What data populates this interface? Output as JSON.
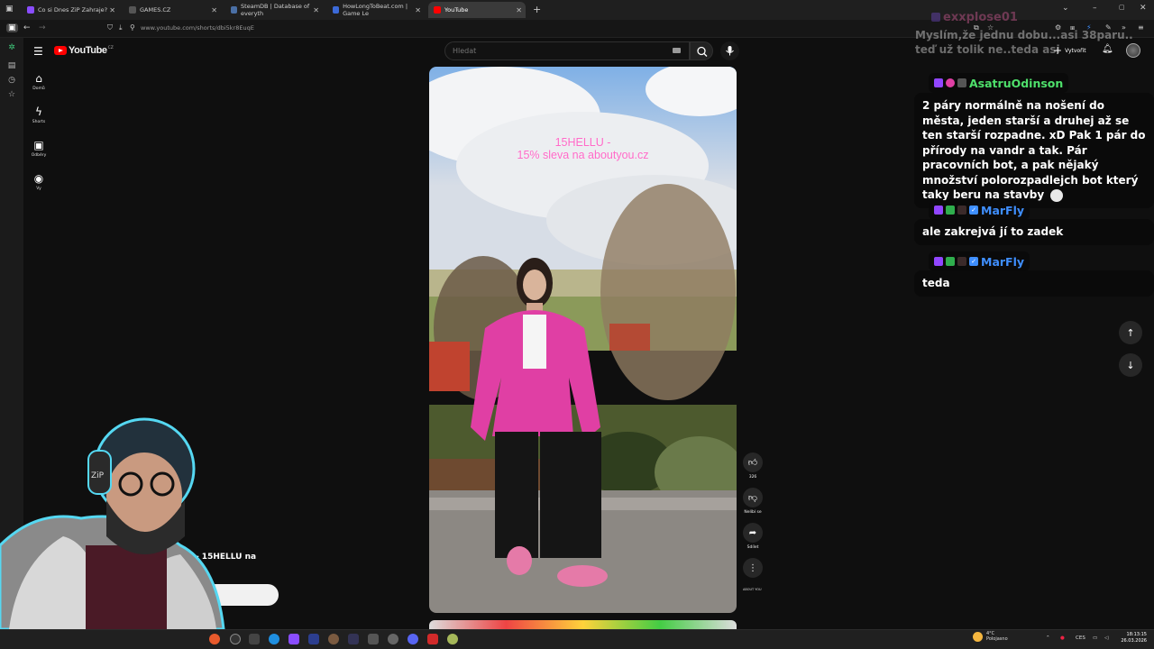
{
  "browser": {
    "tabs": [
      {
        "title": "Co si Dnes ZiP Zahraje?",
        "favicon_color": "#8a4dff"
      },
      {
        "title": "GAMES.CZ",
        "favicon_color": "#2a2a2a"
      },
      {
        "title": "SteamDB | Database of everyth",
        "favicon_color": "#4a6fa5"
      },
      {
        "title": "HowLongToBeat.com | Game Le",
        "favicon_color": "#3c6ad8"
      },
      {
        "title": "YouTube",
        "favicon_color": "#ff0000"
      }
    ],
    "active_tab": 4,
    "url": "www.youtube.com/shorts/dbi5kr8EuqE"
  },
  "youtube": {
    "logo_text": "YouTube",
    "country_code": "CZ",
    "search_placeholder": "Hledat",
    "create_label": "Vytvořit",
    "guide": [
      {
        "label": "Domů",
        "icon": "home-icon"
      },
      {
        "label": "Shorts",
        "icon": "shorts-icon"
      },
      {
        "label": "Odběry",
        "icon": "subscriptions-icon"
      },
      {
        "label": "Vy",
        "icon": "you-icon"
      }
    ],
    "short": {
      "promo_line1": "15HELLU -",
      "promo_line2": "15% sleva na aboutyou.cz",
      "likes": "326",
      "dislike_label": "Nelíbí se",
      "share_label": "Sdílet",
      "channel_tag": "ABOUT YOU"
    },
    "behind_overlay_text": "va- 15HELLU na"
  },
  "chat": {
    "faded": {
      "name": "exxplose01",
      "text": "Myslím,že jednu dobu...asi 38paru.. teď už tolik ne..teda asi"
    },
    "messages": [
      {
        "name": "AsatruOdinson",
        "name_color": "#4ee06b",
        "text": "2 páry normálně na nošení do města, jeden starší a druhej až se ten starší rozpadne. xD Pak 1 pár do přírody na vandr a tak. Pár pracovních bot, a pak nějaký množství polorozpadlejch bot který taky beru na stavby"
      },
      {
        "name": "MarFly",
        "name_color": "#3f8fff",
        "text": "ale zakrejvá jí to zadek"
      },
      {
        "name": "MarFly",
        "name_color": "#3f8fff",
        "text": "teda"
      }
    ]
  },
  "taskbar": {
    "weather_temp": "4°C",
    "weather_desc": "Polojasno",
    "language": "CES",
    "time": "18:13:15",
    "date": "26.03.2026"
  }
}
